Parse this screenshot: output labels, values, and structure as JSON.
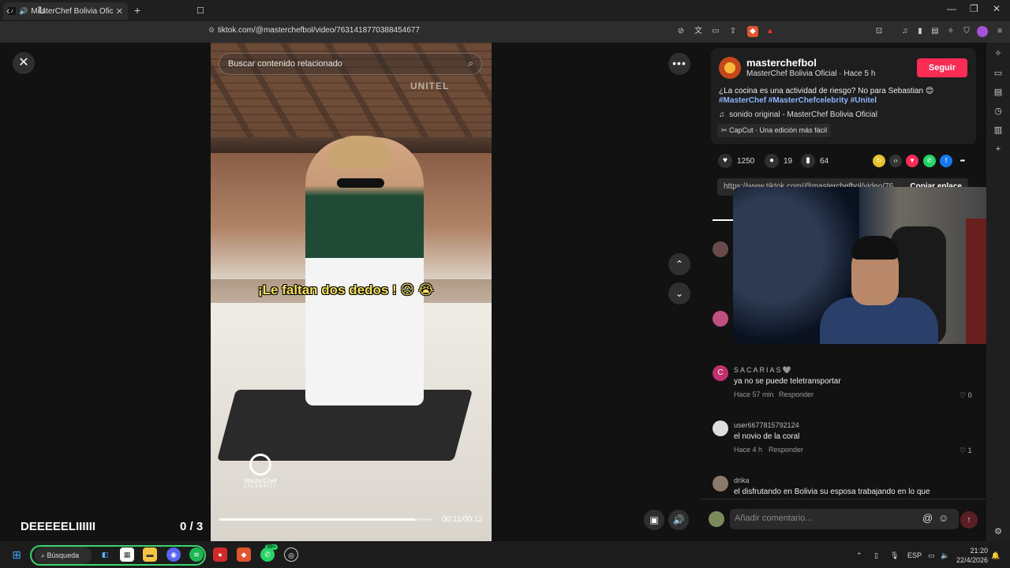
{
  "browser": {
    "tab_title": "MasterChef Bolivia Oficial (@",
    "url": "tiktok.com/@masterchefbol/video/7631418770388454677"
  },
  "video": {
    "search_placeholder": "Buscar contenido relacionado",
    "watermark": "UNITEL",
    "caption": "¡Le faltan dos dedos ! 😥 😭",
    "logo_text": "MasterChef",
    "logo_sub": "CELEBRITY",
    "timecode": "00:11/00:12",
    "progress": 0.92
  },
  "overlay": {
    "stream_name": "DEEEEELIIIIII",
    "stream_score": "0 / 3"
  },
  "post": {
    "username": "masterchefbol",
    "display": "MasterChef Bolivia Oficial · Hace 5 h",
    "follow_label": "Seguir",
    "description": "¿La cocina es una actividad de riesgo? No para Sebastian 😊",
    "hashtags": "#MasterChef #MasterChefcelebrity #Unitel",
    "sound": "sonido original - MasterChef Bolivia Oficial",
    "capcut": "CapCut · Una edición más fácil",
    "likes": "1250",
    "comments": "19",
    "saves": "64",
    "link": "https://www.tiktok.com/@masterchefbol/video/76",
    "copy_label": "Copiar enlace"
  },
  "comments": [
    {
      "avatar_letter": "C",
      "avatar_color": "#c2306e",
      "name": "SACARIAS🩶",
      "text": "ya no se puede teletransportar",
      "time": "Hace 57 min",
      "reply": "Responder",
      "likes": "0"
    },
    {
      "avatar_letter": "",
      "avatar_color": "#dddddd",
      "name": "user6677815792124",
      "text": "el novio de la coral",
      "time": "Hace 4 h",
      "reply": "Responder",
      "likes": "1"
    },
    {
      "avatar_letter": "",
      "avatar_color": "#8a7a6a",
      "name": "drika",
      "text": "el disfrutando en Bolivia su esposa trabajando en lo que",
      "time": "",
      "reply": "",
      "likes": ""
    }
  ],
  "comment_placeholder": "Añadir comentario...",
  "taskbar": {
    "search_label": "Búsqueda",
    "badge": "99+",
    "lang": "ESP",
    "time": "21:20",
    "date": "22/4/2026"
  }
}
